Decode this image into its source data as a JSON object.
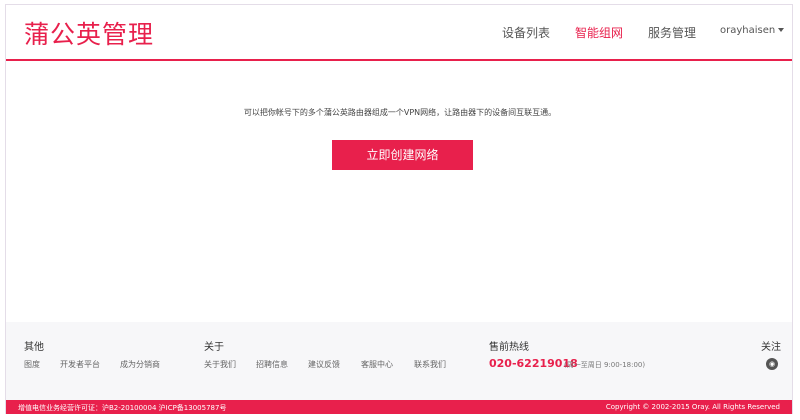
{
  "header": {
    "logo": "蒲公英管理",
    "nav": [
      "设备列表",
      "智能组网",
      "服务管理"
    ],
    "user": "orayhaisen"
  },
  "main": {
    "intro": "可以把你帐号下的多个蒲公英路由器组成一个VPN网络，让路由器下的设备间互联互通。",
    "create_button": "立即创建网络"
  },
  "footer": {
    "other_title": "其他",
    "other_links": [
      "图度",
      "开发者平台",
      "成为分销商"
    ],
    "about_title": "关于",
    "about_links": [
      "关于我们",
      "招聘信息",
      "建议反馈",
      "客服中心",
      "联系我们"
    ],
    "hotline_title": "售前热线",
    "hotline_number": "020-62219018",
    "hotline_hours": "(周一至周日 9:00-18:00)",
    "follow_title": "关注",
    "license": "增值电信业务经营许可证：沪B2-20100004 沪ICP备13005787号",
    "copyright": "Copyright © 2002-2015 Oray. All Rights Reserved"
  },
  "colors": {
    "accent": "#e8204c",
    "footer_bg": "#f7f7f9"
  },
  "icons": {
    "follow": "weibo-icon",
    "user_menu": "caret-down-icon"
  }
}
